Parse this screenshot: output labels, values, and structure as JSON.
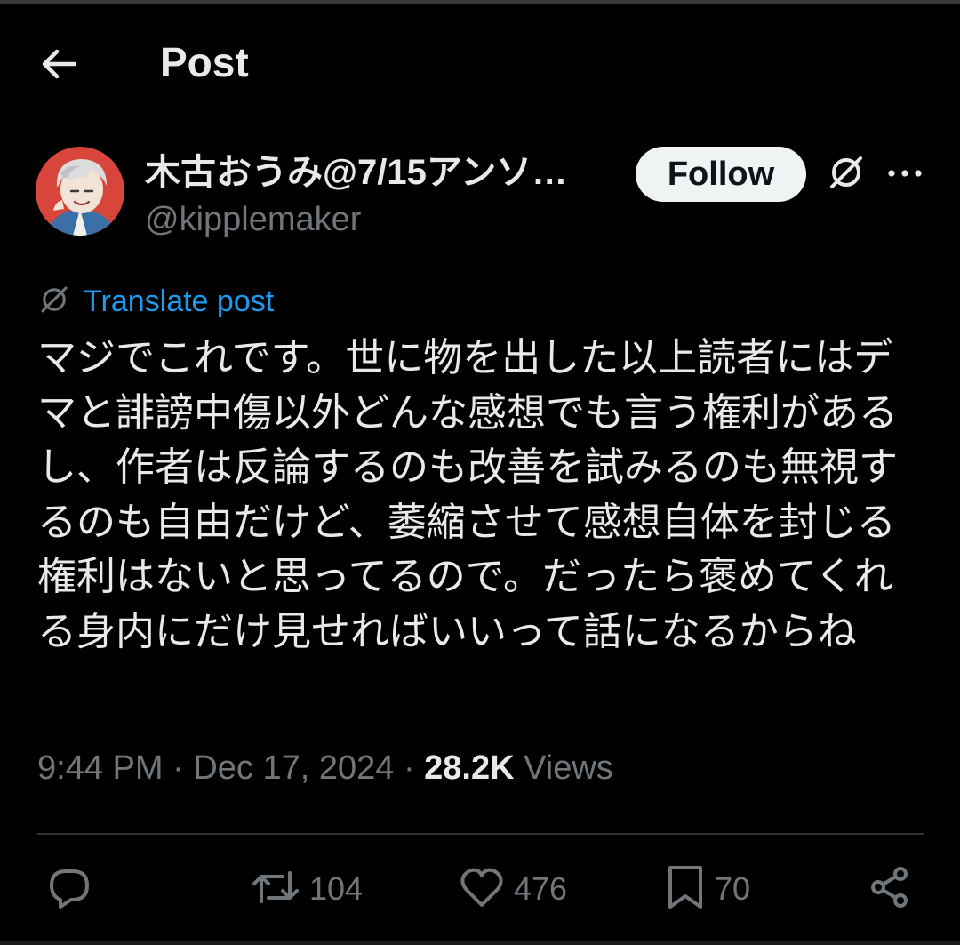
{
  "header": {
    "title": "Post",
    "back_icon": "arrow-left-icon"
  },
  "author": {
    "display_name": "木古おうみ@7/15アンソ…",
    "handle": "@kipplemaker",
    "avatar_icon": "avatar-illustration"
  },
  "actions_top": {
    "follow_label": "Follow",
    "grok_icon": "grok-slash-circle-icon",
    "more_icon": "more-dots-icon"
  },
  "translate": {
    "label": "Translate post",
    "icon": "grok-slash-circle-icon"
  },
  "post": {
    "text": "マジでこれです。世に物を出した以上読者にはデマと誹謗中傷以外どんな感想でも言う権利があるし、作者は反論するのも改善を試みるのも無視するのも自由だけど、萎縮させて感想自体を封じる権利はないと思ってるので。だったら褒めてくれる身内にだけ見せればいいって話になるからね"
  },
  "meta": {
    "time": "9:44 PM",
    "separator": "·",
    "date": "Dec 17, 2024",
    "views_count": "28.2K",
    "views_label": "Views"
  },
  "engagement": {
    "reply_icon": "reply-bubble-icon",
    "retweet_icon": "retweet-icon",
    "retweet_count": "104",
    "like_icon": "heart-icon",
    "like_count": "476",
    "bookmark_icon": "bookmark-icon",
    "bookmark_count": "70",
    "share_icon": "share-icon"
  },
  "colors": {
    "background": "#000000",
    "text_primary": "#e7e9ea",
    "text_secondary": "#71767b",
    "link_blue": "#1d9bf0",
    "follow_bg": "#eff3f4"
  }
}
